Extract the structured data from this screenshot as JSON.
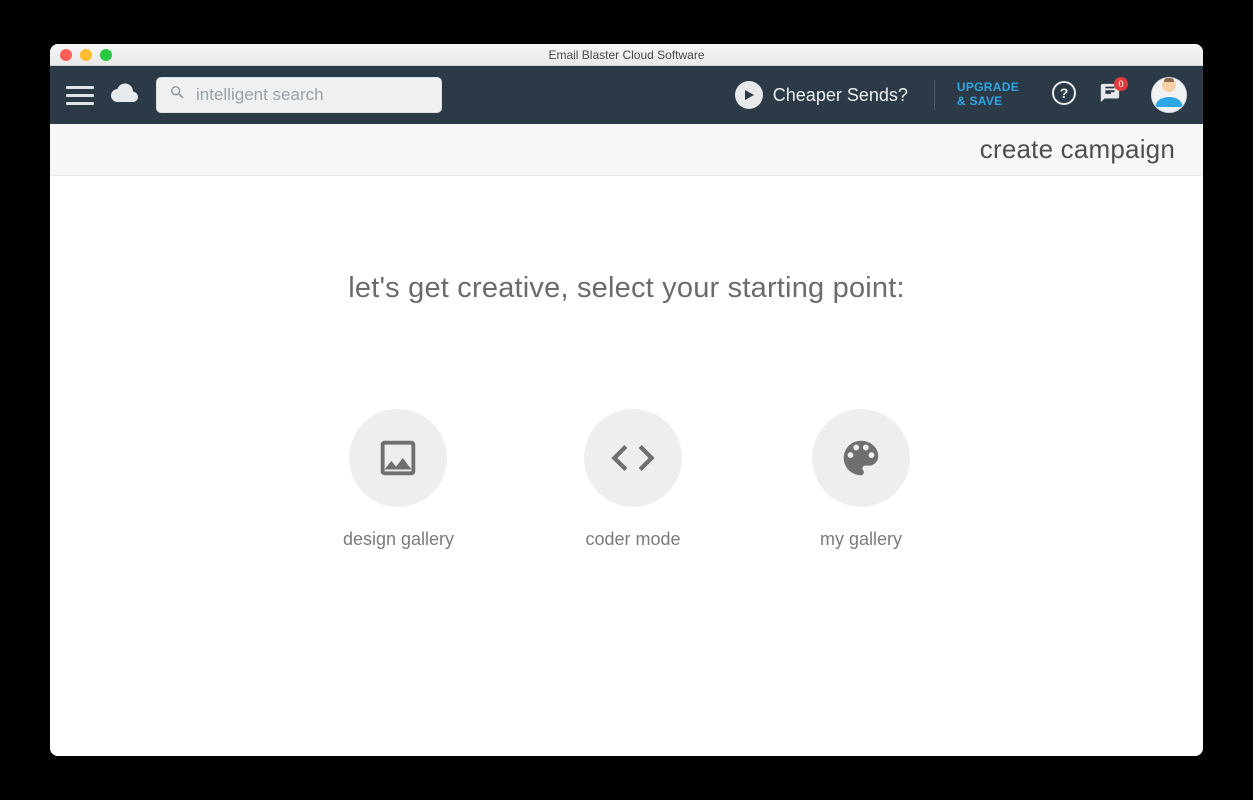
{
  "window": {
    "title": "Email Blaster Cloud Software"
  },
  "topbar": {
    "search_placeholder": "intelligent search",
    "cheaper_label": "Cheaper Sends?",
    "upgrade_line1": "UPGRADE",
    "upgrade_line2": "& SAVE",
    "notification_count": "0"
  },
  "subheader": {
    "title": "create campaign"
  },
  "main": {
    "prompt": "let's get creative, select your starting point:",
    "options": [
      {
        "id": "design-gallery",
        "label": "design gallery"
      },
      {
        "id": "coder-mode",
        "label": "coder mode"
      },
      {
        "id": "my-gallery",
        "label": "my gallery"
      }
    ]
  },
  "colors": {
    "topbar_bg": "#2c3a47",
    "accent": "#2fa7e6",
    "badge": "#e23b3b"
  }
}
